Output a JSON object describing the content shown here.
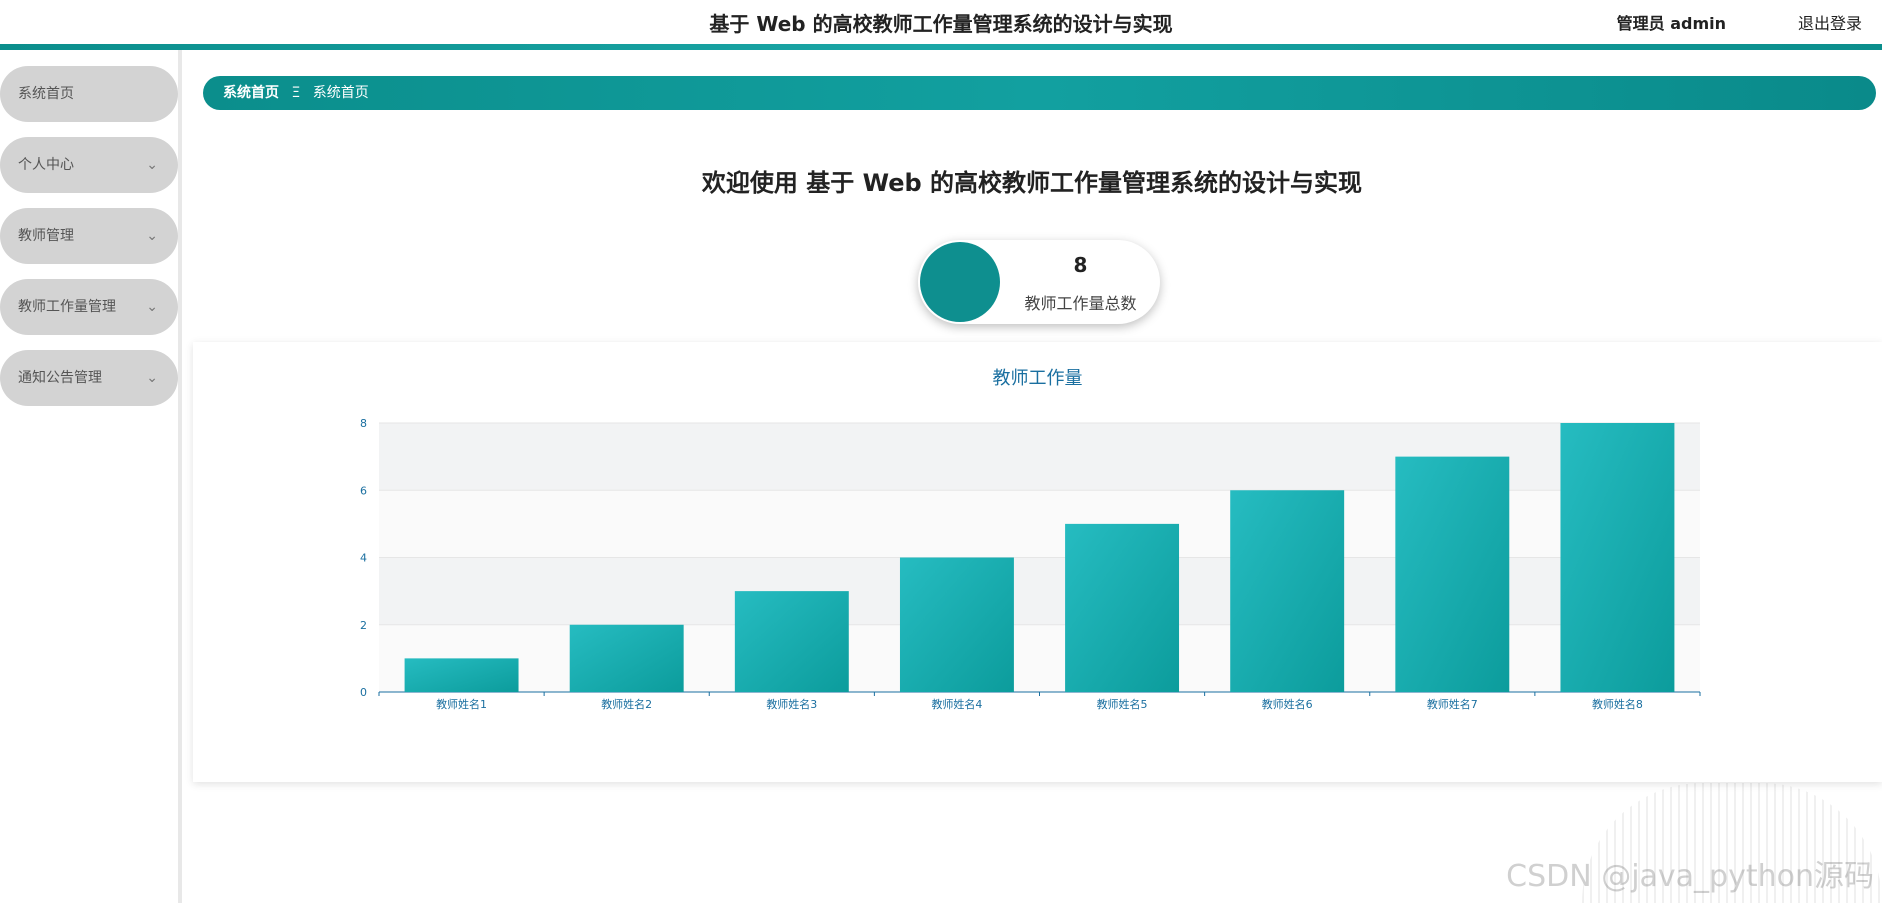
{
  "header": {
    "title": "基于 Web 的高校教师工作量管理系统的设计与实现",
    "user": "管理员 admin",
    "logout": "退出登录"
  },
  "sidebar": {
    "items": [
      {
        "label": "系统首页",
        "expandable": false
      },
      {
        "label": "个人中心",
        "expandable": true
      },
      {
        "label": "教师管理",
        "expandable": true
      },
      {
        "label": "教师工作量管理",
        "expandable": true
      },
      {
        "label": "通知公告管理",
        "expandable": true
      }
    ]
  },
  "breadcrumb": {
    "home": "系统首页",
    "separator": "Ξ",
    "current": "系统首页"
  },
  "welcome": "欢迎使用 基于 Web 的高校教师工作量管理系统的设计与实现",
  "stat": {
    "value": "8",
    "label": "教师工作量总数"
  },
  "watermark": "CSDN @java_python源码",
  "colors": {
    "accent": "#0e8f8f",
    "bar_light": "#26bcc1",
    "bar_dark": "#0c9c9c"
  },
  "chart_data": {
    "type": "bar",
    "title": "教师工作量",
    "categories": [
      "教师姓名1",
      "教师姓名2",
      "教师姓名3",
      "教师姓名4",
      "教师姓名5",
      "教师姓名6",
      "教师姓名7",
      "教师姓名8"
    ],
    "values": [
      1,
      2,
      3,
      4,
      5,
      6,
      7,
      8
    ],
    "ylim": [
      0,
      8
    ],
    "yticks": [
      0,
      2,
      4,
      6,
      8
    ],
    "xlabel": "",
    "ylabel": "",
    "grid": true,
    "legend": "none"
  }
}
